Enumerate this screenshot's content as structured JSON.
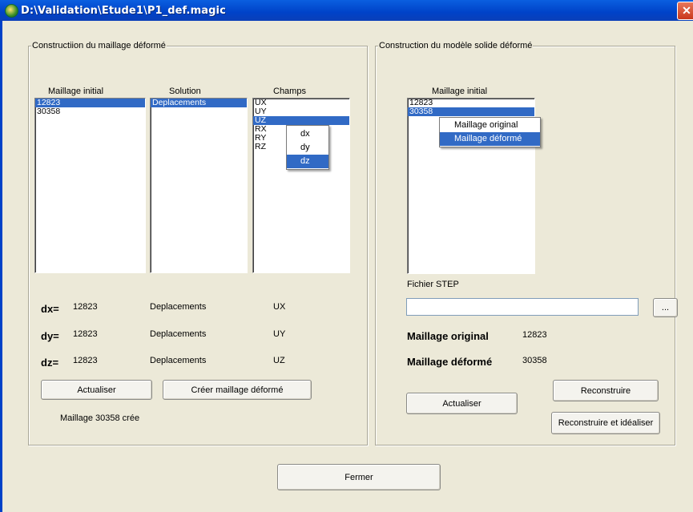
{
  "window": {
    "title": "D:\\Validation\\Etude1\\P1_def.magic",
    "close_glyph": "✕"
  },
  "left": {
    "group_title": "Constructiion du maillage déformé",
    "maillage_header": "Maillage initial",
    "solution_header": "Solution",
    "champs_header": "Champs",
    "maillage_items": [
      "12823",
      "30358"
    ],
    "maillage_selected": 0,
    "solution_items": [
      "Deplacements"
    ],
    "champs_items": [
      "UX",
      "UY",
      "UZ",
      "RX",
      "RY",
      "RZ"
    ],
    "champs_selected": 2,
    "champs_popup": [
      "dx",
      "dy",
      "dz"
    ],
    "champs_popup_selected": 2,
    "rows": [
      {
        "label": "dx=",
        "mesh": "12823",
        "solution": "Deplacements",
        "field": "UX"
      },
      {
        "label": "dy=",
        "mesh": "12823",
        "solution": "Deplacements",
        "field": "UY"
      },
      {
        "label": "dz=",
        "mesh": "12823",
        "solution": "Deplacements",
        "field": "UZ"
      }
    ],
    "actualiser": "Actualiser",
    "creer": "Créer maillage déformé",
    "status": "Maillage 30358 crée"
  },
  "right": {
    "group_title": "Construction du modèle solide déformé",
    "maillage_header": "Maillage initial",
    "maillage_items": [
      "12823",
      "30358"
    ],
    "maillage_selected": 1,
    "popup_items": [
      "Maillage original",
      "Maillage déformé"
    ],
    "popup_selected": 1,
    "fichier_label": "Fichier STEP",
    "fichier_value": "",
    "browse": "...",
    "orig_label": "Maillage original",
    "orig_value": "12823",
    "def_label": "Maillage déformé",
    "def_value": "30358",
    "actualiser": "Actualiser",
    "reconstruire": "Reconstruire",
    "reconstruire_idealiser": "Reconstruire et idéaliser"
  },
  "fermer": "Fermer"
}
